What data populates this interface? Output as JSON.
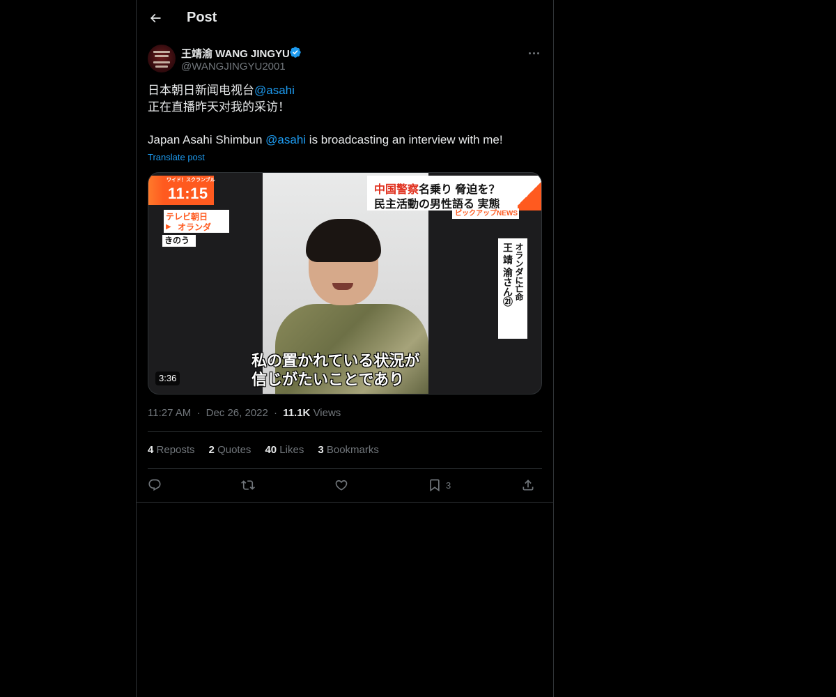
{
  "header": {
    "title": "Post",
    "back_icon": "arrow-left-icon"
  },
  "author": {
    "display_name": "王靖渝 WANG JINGYU",
    "handle": "@WANGJINGYU2001",
    "verified": true,
    "verified_color": "#1d9bf0"
  },
  "tweet": {
    "line1_text": "日本朝日新闻电视台",
    "line1_mention": "@asahi",
    "line2": "正在直播昨天对我的采访！",
    "line3_before": "Japan Asahi Shimbun ",
    "line3_mention": "@asahi",
    "line3_after": " is broadcasting an interview with me!",
    "translate_label": "Translate post"
  },
  "media": {
    "clock_small": "ワイド！スクランブル",
    "clock_time": "11:15",
    "channel_name": "テレビ朝日",
    "channel_location": "オランダ",
    "yesterday": "きのう",
    "headline_red": "中国警察",
    "headline_line1_rest": "名乗り 脅迫を？",
    "headline_line2": "民主活動の男性語る 実態",
    "pickup_label": "ピックアップNEWS",
    "side_label_a": "オランダに亡命",
    "side_label_b": "王 靖 渝さん㉑",
    "subtitle_line1": "私の置かれている状況が",
    "subtitle_line2": "信じがたいことであり",
    "duration": "3:36"
  },
  "meta": {
    "time": "11:27 AM",
    "separator": "·",
    "date": "Dec 26, 2022",
    "views_count": "11.1K",
    "views_label": "Views"
  },
  "stats": [
    {
      "count": "4",
      "label": "Reposts"
    },
    {
      "count": "2",
      "label": "Quotes"
    },
    {
      "count": "40",
      "label": "Likes"
    },
    {
      "count": "3",
      "label": "Bookmarks"
    }
  ],
  "actions": {
    "reply_icon": "reply-icon",
    "repost_icon": "repost-icon",
    "like_icon": "heart-icon",
    "bookmark_icon": "bookmark-icon",
    "bookmark_count": "3",
    "share_icon": "share-icon"
  },
  "colors": {
    "background": "#000000",
    "text": "#e7e9ea",
    "secondary": "#71767b",
    "accent": "#1d9bf0",
    "border": "#2f3336"
  }
}
